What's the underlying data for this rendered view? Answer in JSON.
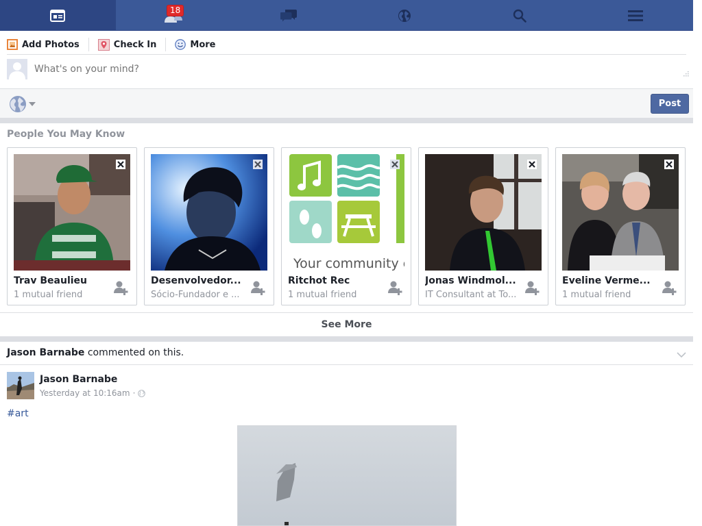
{
  "topnav": {
    "badge_count": "18",
    "items": [
      {
        "icon": "news-feed-icon",
        "active": true
      },
      {
        "icon": "friend-requests-icon"
      },
      {
        "icon": "messages-icon"
      },
      {
        "icon": "notifications-globe-icon"
      },
      {
        "icon": "search-icon"
      },
      {
        "icon": "menu-icon"
      }
    ]
  },
  "composer": {
    "actions": [
      {
        "label": "Add Photos",
        "icon": "add-photos-icon"
      },
      {
        "label": "Check In",
        "icon": "check-in-icon"
      },
      {
        "label": "More",
        "icon": "smiley-icon"
      }
    ],
    "placeholder": "What's on your mind?",
    "post_label": "Post"
  },
  "pymk": {
    "title": "People You May Know",
    "cards": [
      {
        "name": "Trav Beaulieu",
        "sub": "1 mutual friend"
      },
      {
        "name": "Desenvolvedor...",
        "sub": "Sócio-Fundador e ..."
      },
      {
        "name": "Ritchot Rec",
        "sub": "1 mutual friend",
        "photo_text": "Your community e"
      },
      {
        "name": "Jonas Windmol...",
        "sub": "IT Consultant at To..."
      },
      {
        "name": "Eveline Verme...",
        "sub": "1 mutual friend"
      }
    ],
    "see_more": "See More"
  },
  "story": {
    "header_name": "Jason Barnabe",
    "header_action": " commented on this.",
    "author": "Jason Barnabe",
    "time": "Yesterday at 10:16am",
    "time_sep": "·",
    "hashtag": "#art"
  },
  "colors": {
    "brand": "#3b5998",
    "badge": "#e02a2a",
    "link": "#365899",
    "post_button": "#4e69a2"
  }
}
